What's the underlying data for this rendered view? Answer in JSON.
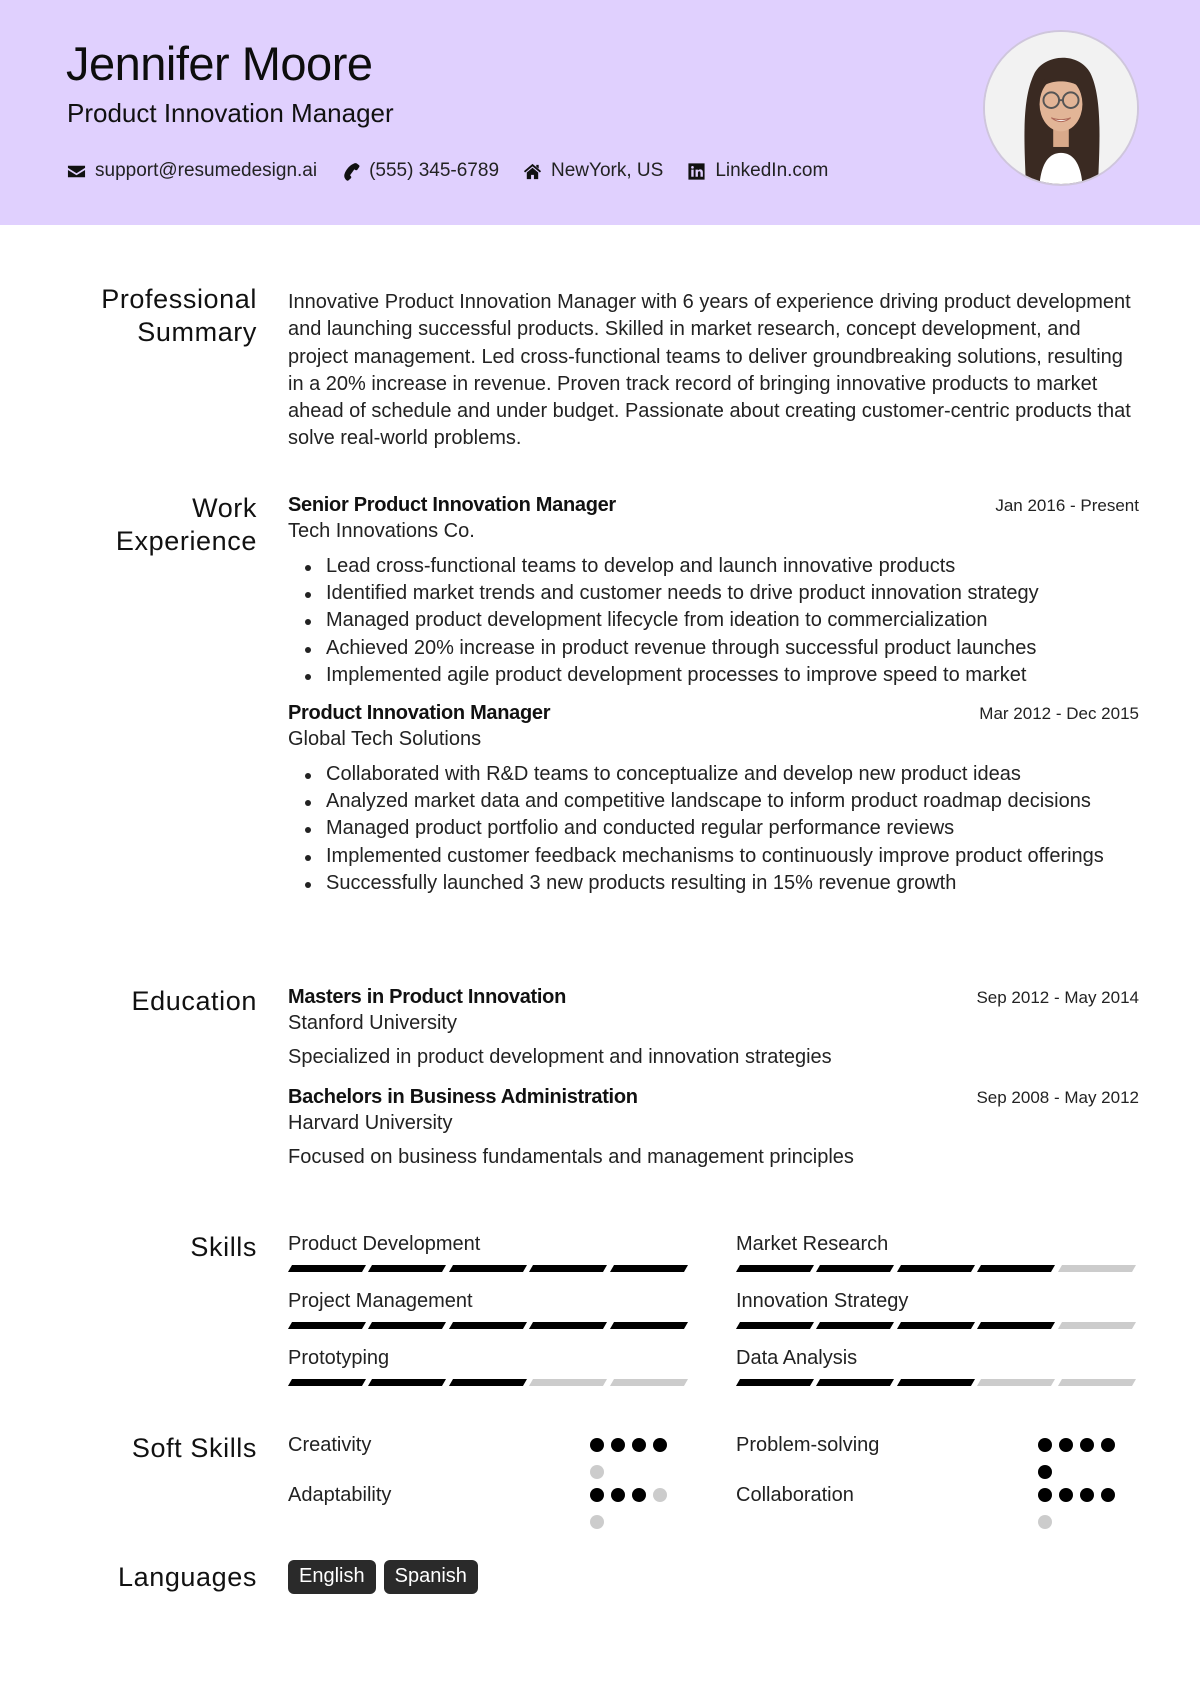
{
  "header": {
    "name": "Jennifer Moore",
    "title": "Product Innovation Manager",
    "contacts": [
      {
        "icon": "envelope-icon",
        "text": "support@resumedesign.ai"
      },
      {
        "icon": "phone-icon",
        "text": "(555) 345-6789"
      },
      {
        "icon": "home-icon",
        "text": "NewYork, US"
      },
      {
        "icon": "linkedin-icon",
        "text": "LinkedIn.com"
      }
    ],
    "accent_color": "#e0d0fe"
  },
  "summary": {
    "heading_line1": "Professional",
    "heading_line2": "Summary",
    "text": "Innovative Product Innovation Manager with 6 years of experience driving product development and launching successful products. Skilled in market research, concept development, and project management. Led cross-functional teams to deliver groundbreaking solutions, resulting in a 20% increase in revenue. Proven track record of bringing innovative products to market ahead of schedule and under budget. Passionate about creating customer-centric products that solve real-world problems."
  },
  "experience": {
    "heading_line1": "Work",
    "heading_line2": "Experience",
    "jobs": [
      {
        "role": "Senior Product Innovation Manager",
        "company": "Tech Innovations Co.",
        "dates": "Jan 2016 - Present",
        "bullets": [
          "Lead cross-functional teams to develop and launch innovative products",
          "Identified market trends and customer needs to drive product innovation strategy",
          "Managed product development lifecycle from ideation to commercialization",
          "Achieved 20% increase in product revenue through successful product launches",
          "Implemented agile product development processes to improve speed to market"
        ]
      },
      {
        "role": "Product Innovation Manager",
        "company": "Global Tech Solutions",
        "dates": "Mar 2012 - Dec 2015",
        "bullets": [
          "Collaborated with R&D teams to conceptualize and develop new product ideas",
          "Analyzed market data and competitive landscape to inform product roadmap decisions",
          "Managed product portfolio and conducted regular performance reviews",
          "Implemented customer feedback mechanisms to continuously improve product offerings",
          "Successfully launched 3 new products resulting in 15% revenue growth"
        ]
      }
    ]
  },
  "education": {
    "heading": "Education",
    "items": [
      {
        "degree": "Masters in Product Innovation",
        "school": "Stanford University",
        "dates": "Sep 2012 - May 2014",
        "description": "Specialized in product development and innovation strategies"
      },
      {
        "degree": "Bachelors in Business Administration",
        "school": "Harvard University",
        "dates": "Sep 2008 - May 2012",
        "description": "Focused on business fundamentals and management principles"
      }
    ]
  },
  "skills": {
    "heading": "Skills",
    "max": 5,
    "items": [
      {
        "name": "Product Development",
        "level": 5
      },
      {
        "name": "Market Research",
        "level": 4
      },
      {
        "name": "Project Management",
        "level": 5
      },
      {
        "name": "Innovation Strategy",
        "level": 4
      },
      {
        "name": "Prototyping",
        "level": 3
      },
      {
        "name": "Data Analysis",
        "level": 3
      }
    ]
  },
  "soft_skills": {
    "heading": "Soft Skills",
    "max": 5,
    "items": [
      {
        "name": "Creativity",
        "level": 4
      },
      {
        "name": "Problem-solving",
        "level": 5
      },
      {
        "name": "Adaptability",
        "level": 3
      },
      {
        "name": "Collaboration",
        "level": 4
      }
    ]
  },
  "languages": {
    "heading": "Languages",
    "items": [
      "English",
      "Spanish"
    ]
  }
}
